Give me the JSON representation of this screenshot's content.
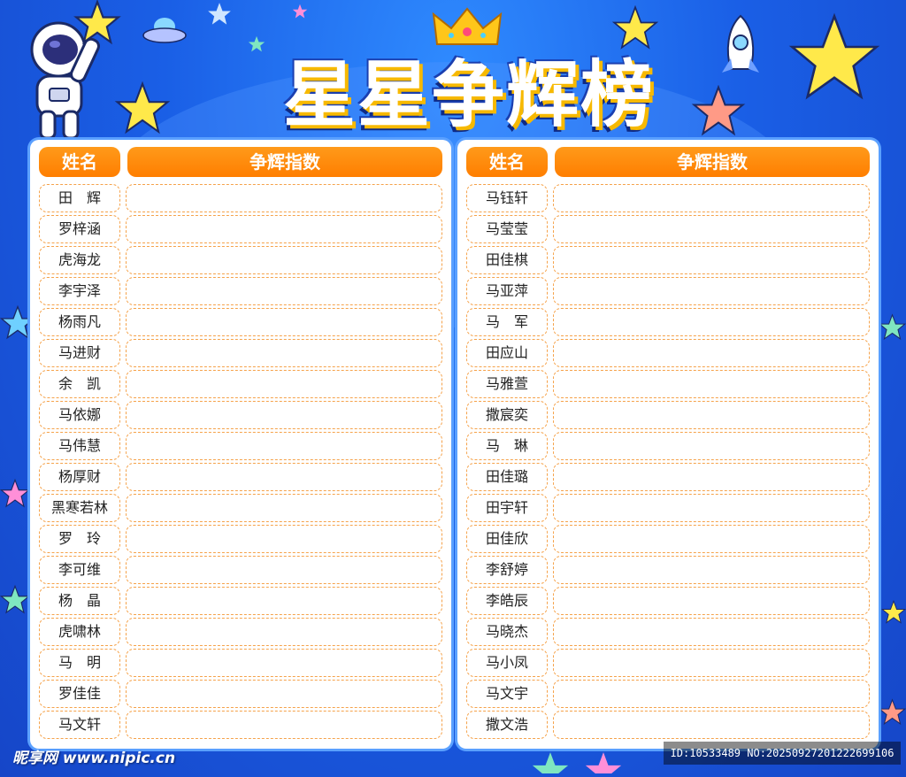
{
  "title": "星星争辉榜",
  "header": {
    "name_label": "姓名",
    "score_label": "争辉指数"
  },
  "left_names": [
    "田　辉",
    "罗梓涵",
    "虎海龙",
    "李宇泽",
    "杨雨凡",
    "马进财",
    "余　凯",
    "马依娜",
    "马伟慧",
    "杨厚财",
    "黑寒若林",
    "罗　玲",
    "李可维",
    "杨　晶",
    "虎啸林",
    "马　明",
    "罗佳佳",
    "马文轩"
  ],
  "right_names": [
    "马钰轩",
    "马莹莹",
    "田佳棋",
    "马亚萍",
    "马　军",
    "田应山",
    "马雅萱",
    "撒宸奕",
    "马　琳",
    "田佳璐",
    "田宇轩",
    "田佳欣",
    "李舒婷",
    "李皓辰",
    "马晓杰",
    "马小凤",
    "马文宇",
    "撒文浩"
  ],
  "watermark": {
    "left": "昵享网 www.nipic.cn",
    "right": "ID:10533489 NO:20250927201222699106"
  },
  "colors": {
    "background": "#1a5fe6",
    "header": "#ff8400",
    "border": "#f5a24a",
    "star": "#ffe94a"
  },
  "icons": [
    "astronaut-icon",
    "crown-icon",
    "star-icon",
    "rocket-icon",
    "ufo-icon"
  ]
}
